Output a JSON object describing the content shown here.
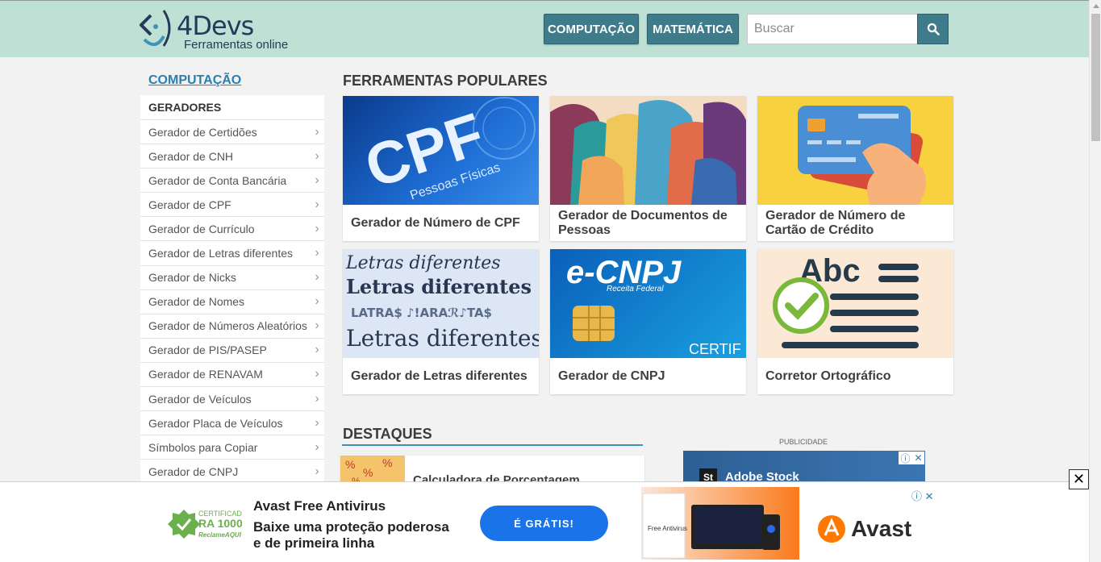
{
  "header": {
    "logo_name": "4Devs",
    "logo_tagline": "Ferramentas online",
    "nav_computacao": "COMPUTAÇÃO",
    "nav_matematica": "MATEMÁTICA",
    "search_placeholder": "Buscar"
  },
  "sidebar": {
    "title": "COMPUTAÇÃO",
    "section": "GERADORES",
    "items": [
      {
        "label": "Gerador de Certidões"
      },
      {
        "label": "Gerador de CNH"
      },
      {
        "label": "Gerador de Conta Bancária"
      },
      {
        "label": "Gerador de CPF"
      },
      {
        "label": "Gerador de Currículo"
      },
      {
        "label": "Gerador de Letras diferentes"
      },
      {
        "label": "Gerador de Nicks"
      },
      {
        "label": "Gerador de Nomes"
      },
      {
        "label": "Gerador de Números Aleatórios"
      },
      {
        "label": "Gerador de PIS/PASEP"
      },
      {
        "label": "Gerador de RENAVAM"
      },
      {
        "label": "Gerador de Veículos"
      },
      {
        "label": "Gerador Placa de Veículos"
      },
      {
        "label": "Símbolos para Copiar"
      },
      {
        "label": "Gerador de CNPJ"
      }
    ]
  },
  "popular": {
    "title": "FERRAMENTAS POPULARES",
    "cards": [
      {
        "label": "Gerador de Número de CPF",
        "image_text_1": "CPF",
        "image_text_2": "Pessoas Físicas"
      },
      {
        "label": "Gerador de Documentos de Pessoas"
      },
      {
        "label": "Gerador de Número de Cartão de Crédito"
      },
      {
        "label": "Gerador de Letras diferentes",
        "image_text_1": "Letras diferentes",
        "image_text_2": "Letras diferentes",
        "image_text_3": "LATRA$  ♪!ARAℛ♪TA$",
        "image_text_4": "Letras diferentes"
      },
      {
        "label": "Gerador de CNPJ",
        "image_text_1": "e-CNPJ",
        "image_text_2": "Receita Federal",
        "image_text_3": "CERTIF"
      },
      {
        "label": "Corretor Ortográfico",
        "image_text_1": "Abc"
      }
    ]
  },
  "highlights": {
    "title": "DESTAQUES",
    "item_label": "Calculadora de Porcentagem"
  },
  "publicity": {
    "label": "PUBLICIDADE",
    "ad_logo": "St",
    "ad_text": "Adobe Stock"
  },
  "bottom_ad": {
    "badge_line1": "CERTIFICADO",
    "badge_line2": "RA 1000",
    "badge_line3": "ReclameAQUI",
    "title": "Avast Free Antivirus",
    "body": "Baixe uma proteção poderosa e de primeira linha",
    "cta": "É GRÁTIS!",
    "product_name": "Free Antivirus",
    "brand": "Avast"
  },
  "colors": {
    "header_bg": "#bfe1d5",
    "accent": "#3e7c8b",
    "link": "#2a7fae",
    "cta": "#1a73e8"
  }
}
